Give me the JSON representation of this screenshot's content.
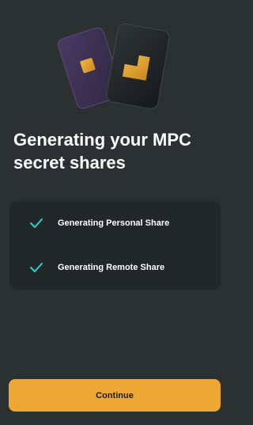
{
  "header": {
    "title_line1": "Generating your MPC",
    "title_line2": "secret shares"
  },
  "status": {
    "items": [
      {
        "label": "Generating Personal Share",
        "icon": "check-icon",
        "done": true
      },
      {
        "label": "Generating Remote Share",
        "icon": "check-icon",
        "done": true
      }
    ]
  },
  "actions": {
    "continue_label": "Continue"
  },
  "colors": {
    "background": "#2b3031",
    "card": "#222728",
    "accent": "#efa733",
    "check": "#2fd0cf",
    "purple_card": "#3e3152"
  }
}
